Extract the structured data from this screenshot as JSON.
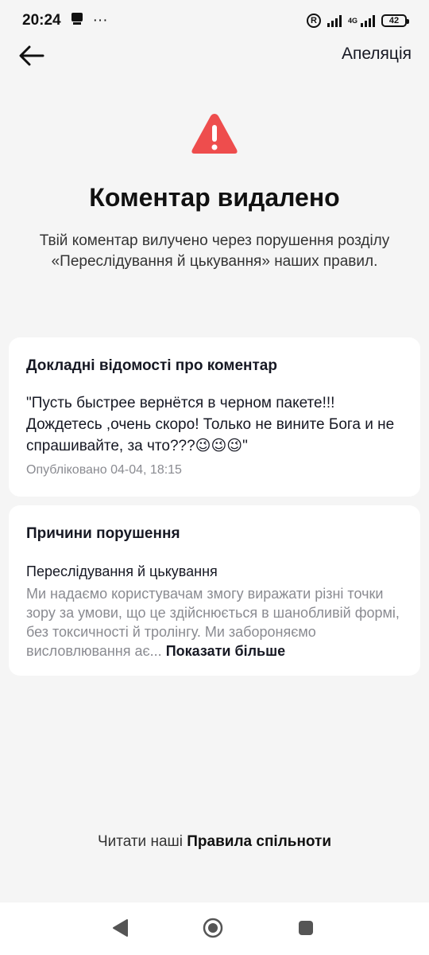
{
  "status_bar": {
    "time": "20:24",
    "more": "···",
    "network": "4G",
    "battery": "42"
  },
  "header": {
    "back_icon": "arrow-left-icon",
    "appeal_label": "Апеляція"
  },
  "notice": {
    "icon": "warning-triangle-icon",
    "title": "Коментар видалено",
    "description": "Твій коментар вилучено через порушення розділу «Переслідування й цькування» наших правил."
  },
  "comment_details": {
    "title": "Докладні відомості про коментар",
    "text": "\"Пусть быстрее вернётся в черном пакете!!! Дождетесь ,очень скоро! Только не вините Бога и не спрашивайте, за что???😉😉😉\"",
    "published": "Опубліковано 04-04, 18:15"
  },
  "violation": {
    "title": "Причини порушення",
    "reason_name": "Переслідування й цькування",
    "reason_text": "Ми надаємо користувачам змогу виражати різні точки зору за умови, що це здійснюється в шанобливій формі, без токсичності й тролінгу. Ми забороняємо висловлювання ає...",
    "show_more": "Показати більше"
  },
  "footer": {
    "rules_prefix": "Читати наші",
    "rules_link": "Правила спільноти"
  },
  "colors": {
    "warning": "#ee4d4d",
    "background": "#f5f5f5",
    "card": "#ffffff"
  }
}
